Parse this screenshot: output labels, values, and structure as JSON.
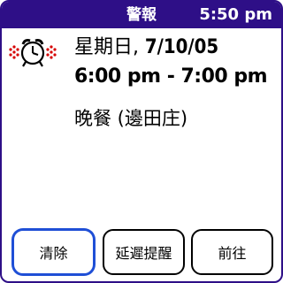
{
  "titlebar": {
    "title": "警報",
    "clock": "5:50 pm"
  },
  "alarm": {
    "icon": "alarm-clock-icon",
    "weekday": "星期日,",
    "date": " 7/10/05",
    "time_range": "6:00 pm - 7:00 pm",
    "event": "晚餐 (邊田庄)"
  },
  "buttons": {
    "clear": "清除",
    "snooze": "延遲提醒",
    "goto": "前往"
  },
  "colors": {
    "titlebar": "#2e0f87",
    "focus": "#1f4fd6",
    "icon_dots": "#d60000"
  }
}
